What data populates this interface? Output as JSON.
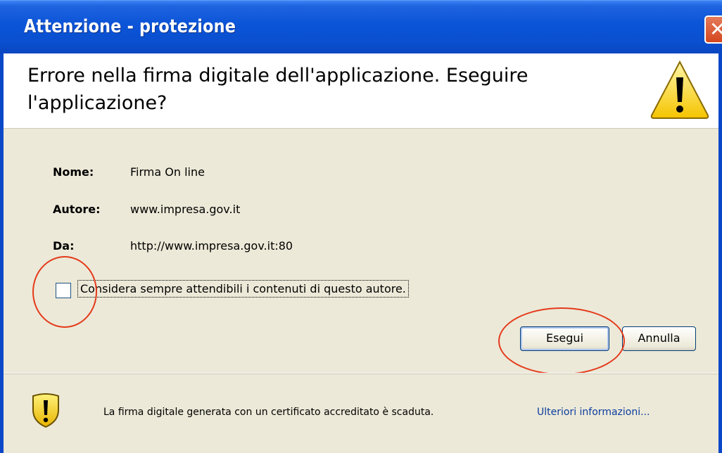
{
  "window": {
    "title": "Attenzione - protezione",
    "close_symbol": "✕"
  },
  "header": {
    "message": "Errore nella firma digitale dell'applicazione. Eseguire l'applicazione?",
    "icon": "warning-triangle-icon"
  },
  "details": [
    {
      "label": "Nome:",
      "value": "Firma On line"
    },
    {
      "label": "Autore:",
      "value": "www.impresa.gov.it"
    },
    {
      "label": "Da:",
      "value": "http://www.impresa.gov.it:80"
    }
  ],
  "trust_checkbox": {
    "label": "Considera sempre attendibili i contenuti di questo autore.",
    "checked": false
  },
  "buttons": {
    "run": "Esegui",
    "cancel": "Annulla"
  },
  "footer": {
    "icon": "shield-warning-icon",
    "text": "La firma digitale generata con un certificato accreditato è scaduta.",
    "link": "Ulteriori informazioni..."
  },
  "colors": {
    "titlebar": "#0a4fcf",
    "dialog_bg": "#ece9d8",
    "annotation_circle": "#e43a1b",
    "link": "#0b3c9e"
  }
}
